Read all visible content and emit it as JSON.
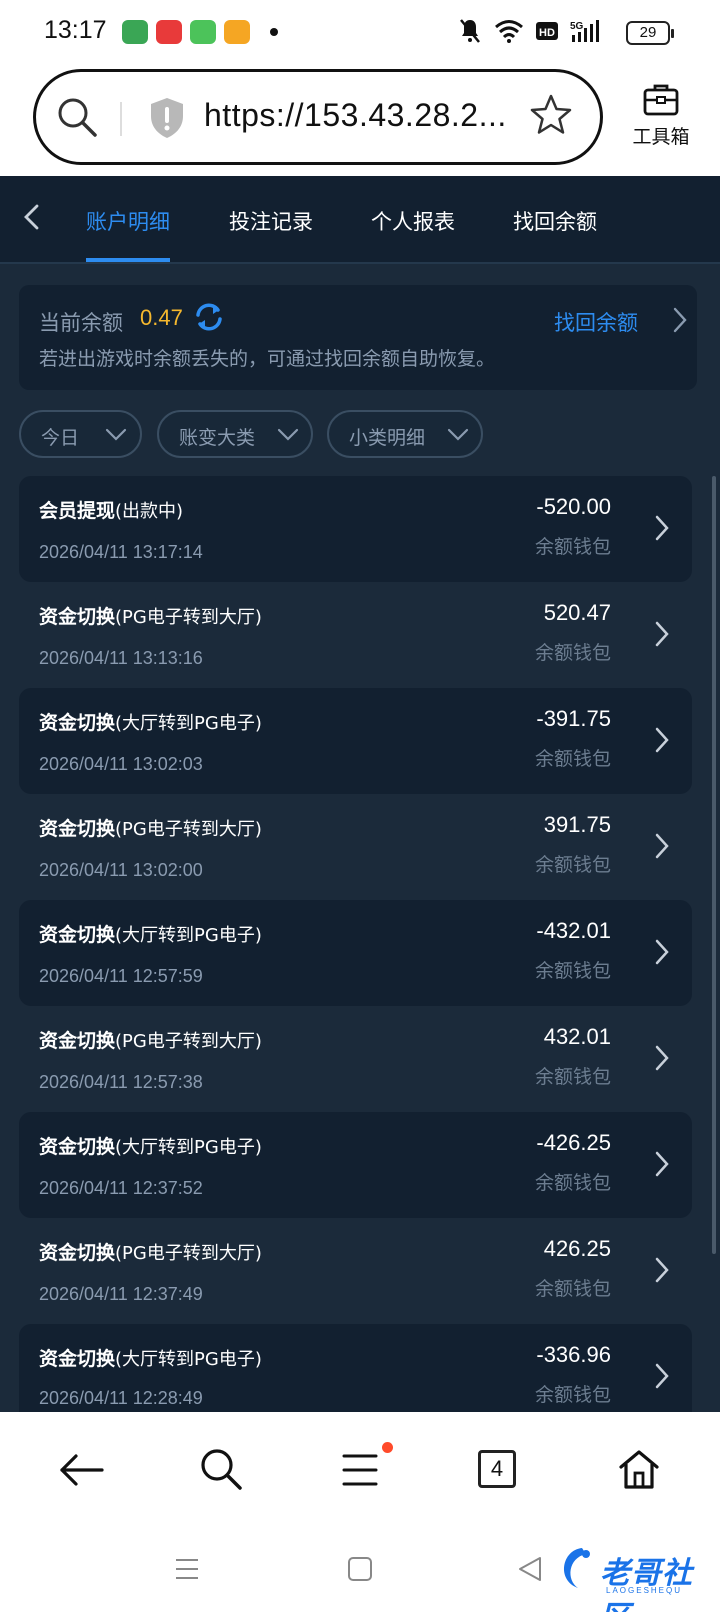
{
  "status": {
    "time": "13:17",
    "battery": "29",
    "app_icon_colors": [
      "#3aa655",
      "#e83a3a",
      "#4cc35a",
      "#f5a623"
    ]
  },
  "browser": {
    "url": "https://153.43.28.2...",
    "toolbox_label": "工具箱"
  },
  "tabs": [
    {
      "label": "账户明细",
      "active": true
    },
    {
      "label": "投注记录",
      "active": false
    },
    {
      "label": "个人报表",
      "active": false
    },
    {
      "label": "找回余额",
      "active": false
    }
  ],
  "balance": {
    "label": "当前余额",
    "value": "0.47",
    "recover_link": "找回余额",
    "hint": "若进出游戏时余额丢失的，可通过找回余额自助恢复。"
  },
  "filters": [
    {
      "label": "今日"
    },
    {
      "label": "账变大类"
    },
    {
      "label": "小类明细"
    }
  ],
  "rows": [
    {
      "title": "会员提现",
      "detail": "(出款中)",
      "date": "2026/04/11 13:17:14",
      "amount": "-520.00",
      "wallet": "余额钱包"
    },
    {
      "title": "资金切换",
      "detail": "(PG电子转到大厅)",
      "date": "2026/04/11 13:13:16",
      "amount": "520.47",
      "wallet": "余额钱包"
    },
    {
      "title": "资金切换",
      "detail": "(大厅转到PG电子)",
      "date": "2026/04/11 13:02:03",
      "amount": "-391.75",
      "wallet": "余额钱包"
    },
    {
      "title": "资金切换",
      "detail": "(PG电子转到大厅)",
      "date": "2026/04/11 13:02:00",
      "amount": "391.75",
      "wallet": "余额钱包"
    },
    {
      "title": "资金切换",
      "detail": "(大厅转到PG电子)",
      "date": "2026/04/11 12:57:59",
      "amount": "-432.01",
      "wallet": "余额钱包"
    },
    {
      "title": "资金切换",
      "detail": "(PG电子转到大厅)",
      "date": "2026/04/11 12:57:38",
      "amount": "432.01",
      "wallet": "余额钱包"
    },
    {
      "title": "资金切换",
      "detail": "(大厅转到PG电子)",
      "date": "2026/04/11 12:37:52",
      "amount": "-426.25",
      "wallet": "余额钱包"
    },
    {
      "title": "资金切换",
      "detail": "(PG电子转到大厅)",
      "date": "2026/04/11 12:37:49",
      "amount": "426.25",
      "wallet": "余额钱包"
    },
    {
      "title": "资金切换",
      "detail": "(大厅转到PG电子)",
      "date": "2026/04/11 12:28:49",
      "amount": "-336.96",
      "wallet": "余额钱包"
    }
  ],
  "bottom_nav": {
    "tab_count": "4"
  },
  "watermark": {
    "text": "老哥社区",
    "sub": "LAOGESHEQU"
  },
  "colors": {
    "accent": "#2d8cf0",
    "balance": "#f5b82e",
    "bg": "#1b2a3a",
    "card": "#122030"
  }
}
